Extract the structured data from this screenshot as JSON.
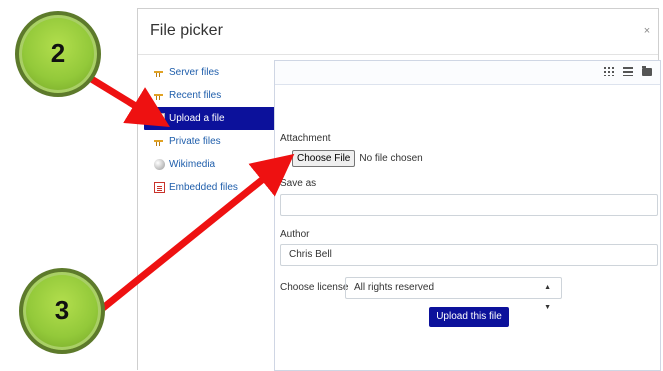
{
  "dialog": {
    "title": "File picker",
    "close_label": "×"
  },
  "sidebar": {
    "items": [
      {
        "label": "Server files",
        "icon": "server-files-icon"
      },
      {
        "label": "Recent files",
        "icon": "recent-files-icon"
      },
      {
        "label": "Upload a file",
        "icon": "upload-file-icon",
        "active": true
      },
      {
        "label": "Private files",
        "icon": "private-files-icon"
      },
      {
        "label": "Wikimedia",
        "icon": "wikimedia-icon"
      },
      {
        "label": "Embedded files",
        "icon": "embedded-files-icon"
      }
    ]
  },
  "toolbar": {
    "icons": [
      "grid-view-icon",
      "list-view-icon",
      "folder-view-icon"
    ]
  },
  "form": {
    "attachment_label": "Attachment",
    "choose_file_label": "Choose File",
    "no_file_text": "No file chosen",
    "save_as_label": "Save as",
    "save_as_value": "",
    "author_label": "Author",
    "author_value": "Chris Bell",
    "license_label": "Choose license",
    "license_value": "All rights reserved",
    "upload_button_label": "Upload this file"
  },
  "callouts": {
    "badge_top": "2",
    "badge_bottom": "3",
    "badge_color": "#93c93a",
    "arrow_color": "#ee1111"
  },
  "colors": {
    "active_item_bg": "#0c119b",
    "link": "#1f5eab",
    "primary_button": "#0c119b"
  }
}
